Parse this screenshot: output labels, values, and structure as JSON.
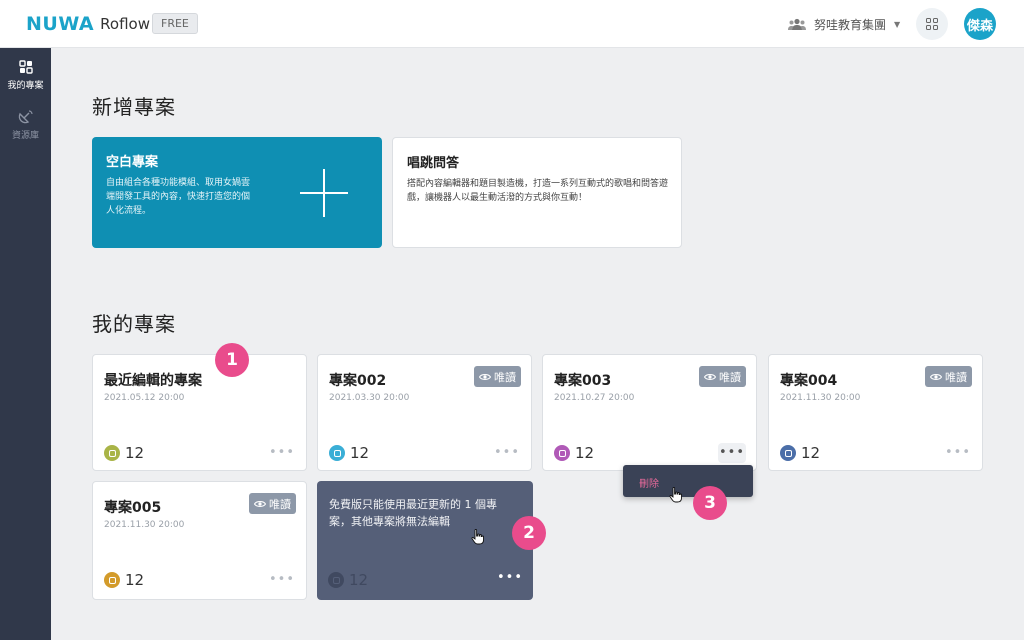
{
  "header": {
    "logo_brand": "NUWA",
    "logo_app": "Roflow",
    "plan": "FREE",
    "org_name": "努哇教育集團",
    "user_initials": "傑森"
  },
  "sidebar": {
    "items": [
      {
        "label": "我的專案",
        "icon": "grid-icon"
      },
      {
        "label": "資源庫",
        "icon": "satellite-dish-icon"
      }
    ]
  },
  "new_section": {
    "title": "新增專案",
    "cards": [
      {
        "title": "空白專案",
        "desc": "自由組合各種功能模組、取用女媧雲端開發工具的內容，快速打造您的個人化流程。"
      },
      {
        "title": "唱跳問答",
        "desc": "搭配內容編輯器和題目製造機，打造一系列互動式的歌唱和問答遊戲，讓機器人以最生動活潑的方式與你互動！"
      }
    ]
  },
  "mine_section": {
    "title": "我的專案",
    "readonly_label": "唯讀",
    "projects": [
      {
        "name": "最近編輯的專案",
        "date": "2021.05.12  20:00",
        "count": "12",
        "readonly": false,
        "color": "#a9b447"
      },
      {
        "name": "專案002",
        "date": "2021.03.30  20:00",
        "count": "12",
        "readonly": true,
        "color": "#3aaed6"
      },
      {
        "name": "專案003",
        "date": "2021.10.27  20:00",
        "count": "12",
        "readonly": true,
        "color": "#b05ab7"
      },
      {
        "name": "專案004",
        "date": "2021.11.30  20:00",
        "count": "12",
        "readonly": true,
        "color": "#4b6ea8"
      },
      {
        "name": "專案005",
        "date": "2021.11.30  20:00",
        "count": "12",
        "readonly": true,
        "color": "#d39b2b"
      }
    ],
    "disabled_card": {
      "message": "免費版只能使用最近更新的 1 個專案，其他專案將無法編輯",
      "count": "12"
    },
    "more_glyph": "•••",
    "dropdown_delete": "刪除"
  },
  "steps": [
    "1",
    "2",
    "3"
  ]
}
